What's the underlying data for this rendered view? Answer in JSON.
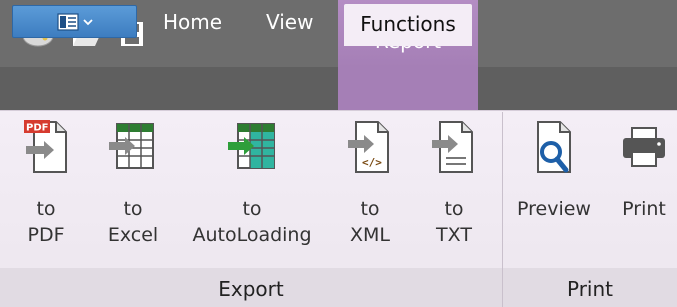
{
  "quick_access": {
    "items": [
      {
        "icon": "palette-icon"
      },
      {
        "icon": "open-folder-icon"
      },
      {
        "icon": "save-disk-icon"
      }
    ]
  },
  "contextual_tab_group": {
    "label": "Report",
    "color": "#a57fb6"
  },
  "tabs": [
    {
      "label": "Home",
      "active": false
    },
    {
      "label": "View",
      "active": false
    },
    {
      "label": "Functions",
      "active": true
    }
  ],
  "file_menu": {
    "icon": "layout-panel-icon",
    "accent": "#4a8acb"
  },
  "groups": {
    "export": {
      "label": "Export",
      "buttons": [
        {
          "line1": "to",
          "line2": "PDF",
          "icon": "pdf-export-icon"
        },
        {
          "line1": "to",
          "line2": "Excel",
          "icon": "excel-export-icon"
        },
        {
          "line1": "to",
          "line2": "AutoLoading",
          "icon": "autoloading-export-icon"
        },
        {
          "line1": "to",
          "line2": "XML",
          "icon": "xml-export-icon"
        },
        {
          "line1": "to",
          "line2": "TXT",
          "icon": "txt-export-icon"
        }
      ]
    },
    "print": {
      "label": "Print",
      "buttons": [
        {
          "line1": "Preview",
          "icon": "print-preview-icon"
        },
        {
          "line1": "Print",
          "icon": "printer-icon"
        }
      ]
    }
  }
}
